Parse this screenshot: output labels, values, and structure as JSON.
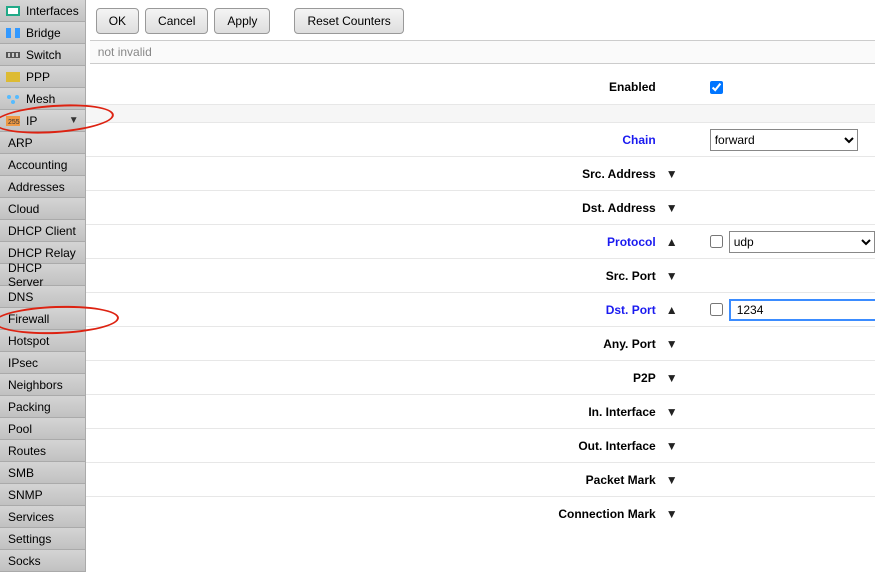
{
  "sidebar": {
    "top": [
      {
        "icon": "interfaces",
        "label": "Interfaces"
      },
      {
        "icon": "bridge",
        "label": "Bridge"
      },
      {
        "icon": "switch",
        "label": "Switch"
      },
      {
        "icon": "ppp",
        "label": "PPP"
      },
      {
        "icon": "mesh",
        "label": "Mesh"
      },
      {
        "icon": "ip",
        "label": "IP",
        "expanded": true
      }
    ],
    "ip_sub": [
      "ARP",
      "Accounting",
      "Addresses",
      "Cloud",
      "DHCP Client",
      "DHCP Relay",
      "DHCP Server",
      "DNS",
      "Firewall",
      "Hotspot",
      "IPsec",
      "Neighbors",
      "Packing",
      "Pool",
      "Routes",
      "SMB",
      "SNMP",
      "Services",
      "Settings",
      "Socks"
    ]
  },
  "toolbar": {
    "ok": "OK",
    "cancel": "Cancel",
    "apply": "Apply",
    "reset": "Reset Counters"
  },
  "subbar": "not invalid",
  "form": {
    "enabled": {
      "label": "Enabled",
      "checked": true
    },
    "chain": {
      "label": "Chain",
      "value": "forward"
    },
    "src_address": {
      "label": "Src. Address",
      "collapsed": true
    },
    "dst_address": {
      "label": "Dst. Address",
      "collapsed": true
    },
    "protocol": {
      "label": "Protocol",
      "collapsed": false,
      "neg": false,
      "value": "udp"
    },
    "src_port": {
      "label": "Src. Port",
      "collapsed": true
    },
    "dst_port": {
      "label": "Dst. Port",
      "collapsed": false,
      "neg": false,
      "value": "1234"
    },
    "any_port": {
      "label": "Any. Port",
      "collapsed": true
    },
    "p2p": {
      "label": "P2P",
      "collapsed": true
    },
    "in_interface": {
      "label": "In. Interface",
      "collapsed": true
    },
    "out_interface": {
      "label": "Out. Interface",
      "collapsed": true
    },
    "packet_mark": {
      "label": "Packet Mark",
      "collapsed": true
    },
    "connection_mark": {
      "label": "Connection Mark",
      "collapsed": true
    }
  },
  "glyphs": {
    "up": "▲",
    "down": "▼"
  }
}
